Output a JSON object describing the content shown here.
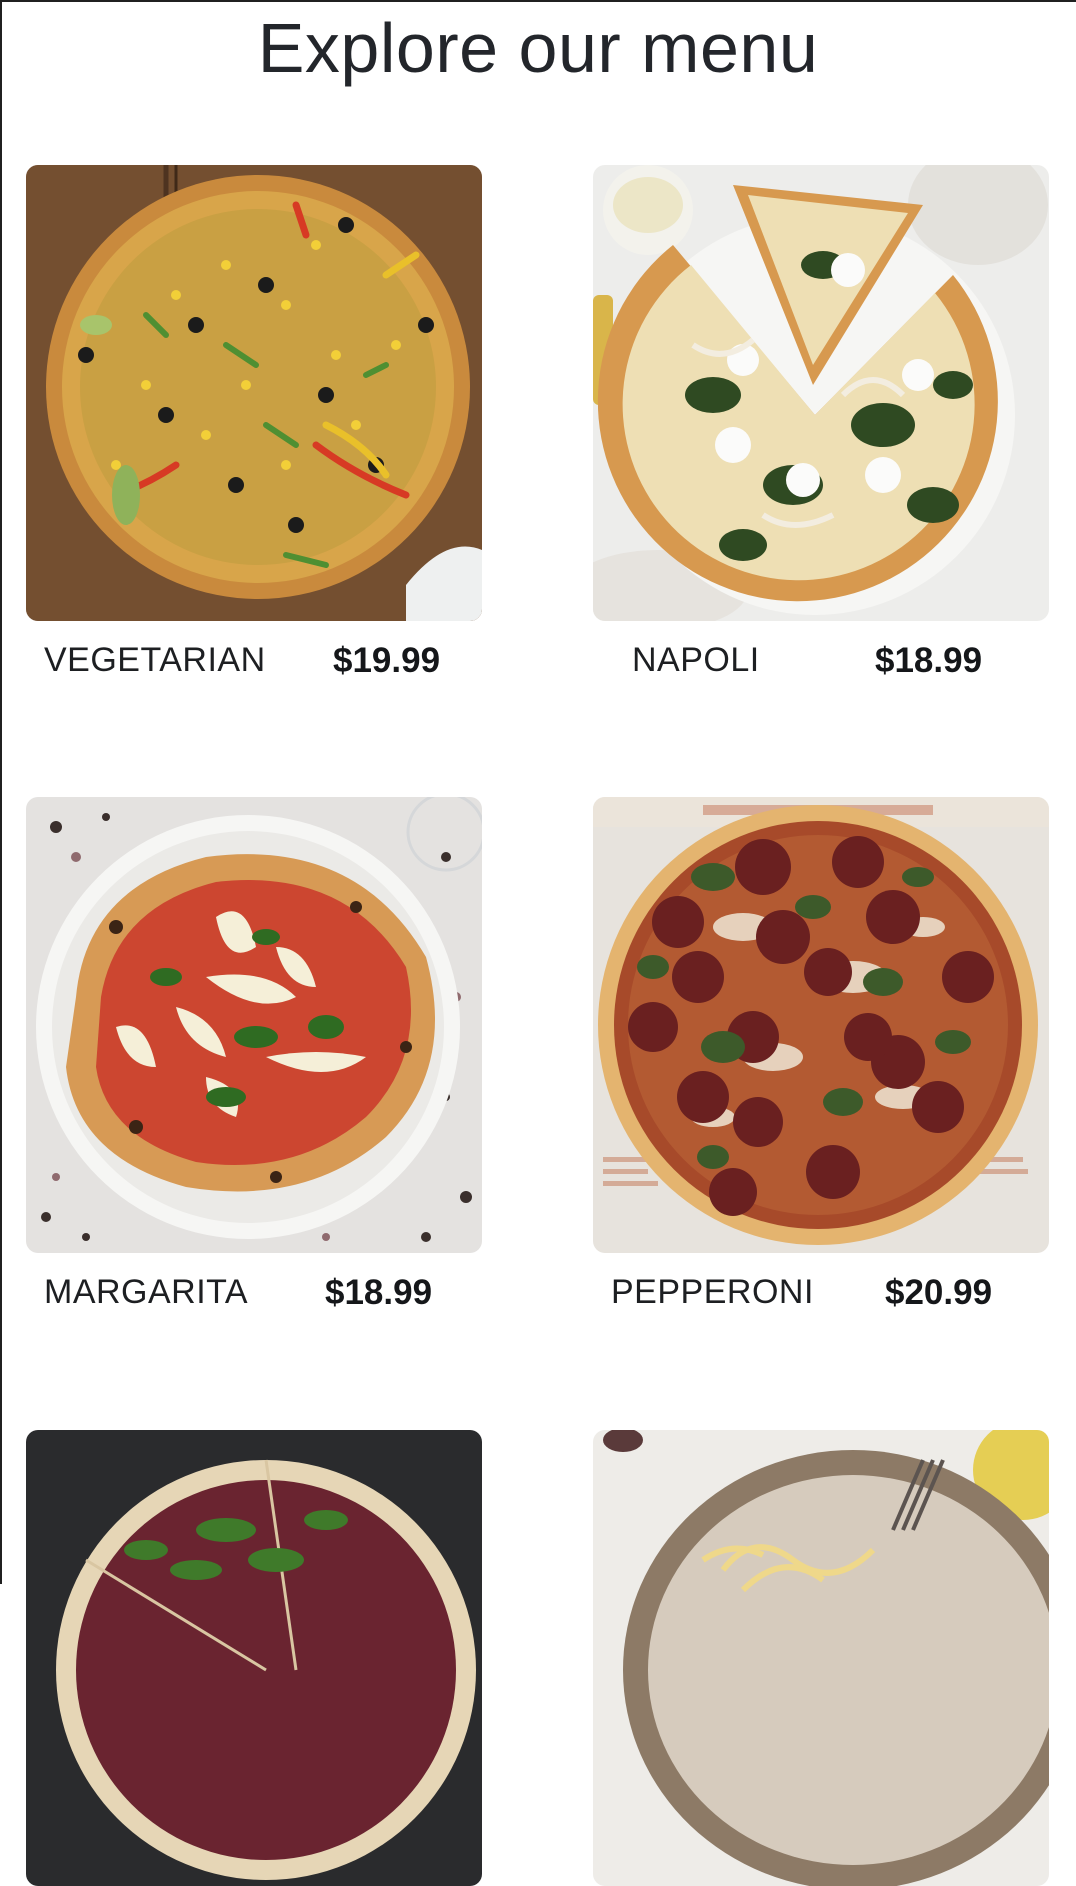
{
  "page": {
    "title": "Explore our menu"
  },
  "menu": {
    "items": [
      {
        "name": "VEGETARIAN",
        "price": "$19.99",
        "photo": "vegetarian-pizza-photo"
      },
      {
        "name": "NAPOLI",
        "price": "$18.99",
        "photo": "napoli-pizza-photo"
      },
      {
        "name": "MARGARITA",
        "price": "$18.99",
        "photo": "margarita-pizza-photo"
      },
      {
        "name": "PEPPERONI",
        "price": "$20.99",
        "photo": "pepperoni-pizza-photo"
      },
      {
        "name": "",
        "price": "",
        "photo": "arugula-pizza-photo"
      },
      {
        "name": "",
        "price": "",
        "photo": "pasta-bowl-photo"
      }
    ]
  },
  "colors": {
    "title": "#23262b",
    "text": "#1d1f22",
    "price": "#15171a",
    "frame": "#202020"
  }
}
